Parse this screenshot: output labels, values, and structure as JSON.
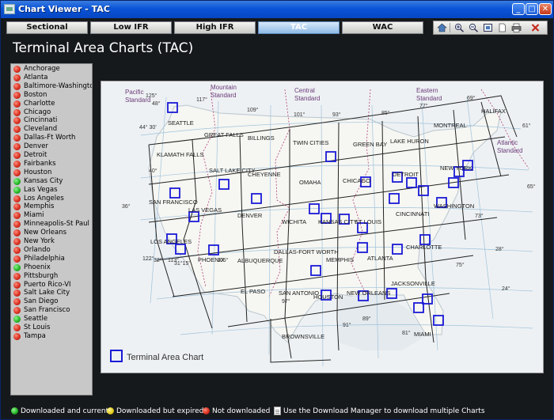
{
  "window": {
    "title": "Chart Viewer - TAC",
    "buttons": [
      "_",
      "□",
      "✕"
    ]
  },
  "tabs": [
    {
      "label": "Sectional",
      "active": false
    },
    {
      "label": "Low IFR",
      "active": false
    },
    {
      "label": "High IFR",
      "active": false
    },
    {
      "label": "TAC",
      "active": true
    },
    {
      "label": "WAC",
      "active": false
    }
  ],
  "toolbar": [
    "home-icon",
    "zoom-in-icon",
    "zoom-out-icon",
    "fit-page-icon",
    "page-icon",
    "print-icon",
    "close-icon"
  ],
  "page_title": "Terminal Area Charts (TAC)",
  "status_colors": {
    "red": "#d42a1a",
    "green": "#22b022",
    "yellow": "#e0c81a"
  },
  "charts": [
    {
      "name": "Anchorage",
      "status": "red"
    },
    {
      "name": "Atlanta",
      "status": "red"
    },
    {
      "name": "Baltimore-Washington",
      "status": "red"
    },
    {
      "name": "Boston",
      "status": "red"
    },
    {
      "name": "Charlotte",
      "status": "red"
    },
    {
      "name": "Chicago",
      "status": "red"
    },
    {
      "name": "Cincinnati",
      "status": "red"
    },
    {
      "name": "Cleveland",
      "status": "red"
    },
    {
      "name": "Dallas-Ft Worth",
      "status": "red"
    },
    {
      "name": "Denver",
      "status": "red"
    },
    {
      "name": "Detroit",
      "status": "red"
    },
    {
      "name": "Fairbanks",
      "status": "red"
    },
    {
      "name": "Houston",
      "status": "red"
    },
    {
      "name": "Kansas City",
      "status": "green"
    },
    {
      "name": "Las Vegas",
      "status": "green"
    },
    {
      "name": "Los Angeles",
      "status": "red"
    },
    {
      "name": "Memphis",
      "status": "red"
    },
    {
      "name": "Miami",
      "status": "red"
    },
    {
      "name": "Minneapolis-St Paul",
      "status": "red"
    },
    {
      "name": "New Orleans",
      "status": "red"
    },
    {
      "name": "New York",
      "status": "red"
    },
    {
      "name": "Orlando",
      "status": "red"
    },
    {
      "name": "Philadelphia",
      "status": "red"
    },
    {
      "name": "Phoenix",
      "status": "green"
    },
    {
      "name": "Pittsburgh",
      "status": "red"
    },
    {
      "name": "Puerto Rico-VI",
      "status": "red"
    },
    {
      "name": "Salt Lake City",
      "status": "red"
    },
    {
      "name": "San Diego",
      "status": "red"
    },
    {
      "name": "San Francisco",
      "status": "red"
    },
    {
      "name": "Seattle",
      "status": "green"
    },
    {
      "name": "St Louis",
      "status": "red"
    },
    {
      "name": "Tampa",
      "status": "red"
    }
  ],
  "map": {
    "timezones": [
      "Pacific Standard",
      "Mountain Standard",
      "Central Standard",
      "Eastern Standard",
      "Atlantic Standard"
    ],
    "sectionals": [
      "SEATTLE",
      "GREAT FALLS",
      "BILLINGS",
      "TWIN CITIES",
      "GREEN BAY",
      "LAKE HURON",
      "MONTREAL",
      "HALIFAX",
      "KLAMATH FALLS",
      "SALT LAKE CITY",
      "CHEYENNE",
      "OMAHA",
      "CHICAGO",
      "DETROIT",
      "NEW YORK",
      "SAN FRANCISCO",
      "LAS VEGAS",
      "DENVER",
      "WICHITA",
      "KANSAS CITY",
      "ST LOUIS",
      "CINCINNATI",
      "WASHINGTON",
      "LOS ANGELES",
      "PHOENIX",
      "ALBUQUERQUE",
      "DALLAS-FORT WORTH",
      "MEMPHIS",
      "ATLANTA",
      "CHARLOTTE",
      "EL PASO",
      "SAN ANTONIO",
      "HOUSTON",
      "NEW ORLEANS",
      "JACKSONVILLE",
      "BROWNSVILLE",
      "MIAMI"
    ],
    "coordinates": [
      "125°",
      "117°",
      "109°",
      "101°",
      "93°",
      "85°",
      "77°",
      "69°",
      "61°",
      "48°",
      "44° 30'",
      "40°",
      "36°",
      "32°",
      "28°",
      "24°",
      "122°",
      "113°",
      "105°",
      "97°",
      "89°",
      "81°",
      "73°",
      "91°",
      "75°",
      "65°",
      "31°15'"
    ],
    "legend_label": "Terminal Area Chart"
  },
  "legend": {
    "downloaded_current": "Downloaded and current",
    "downloaded_expired": "Downloaded but expired",
    "not_downloaded": "Not downloaded",
    "download_manager": "Use the Download Manager to download multiple Charts"
  }
}
